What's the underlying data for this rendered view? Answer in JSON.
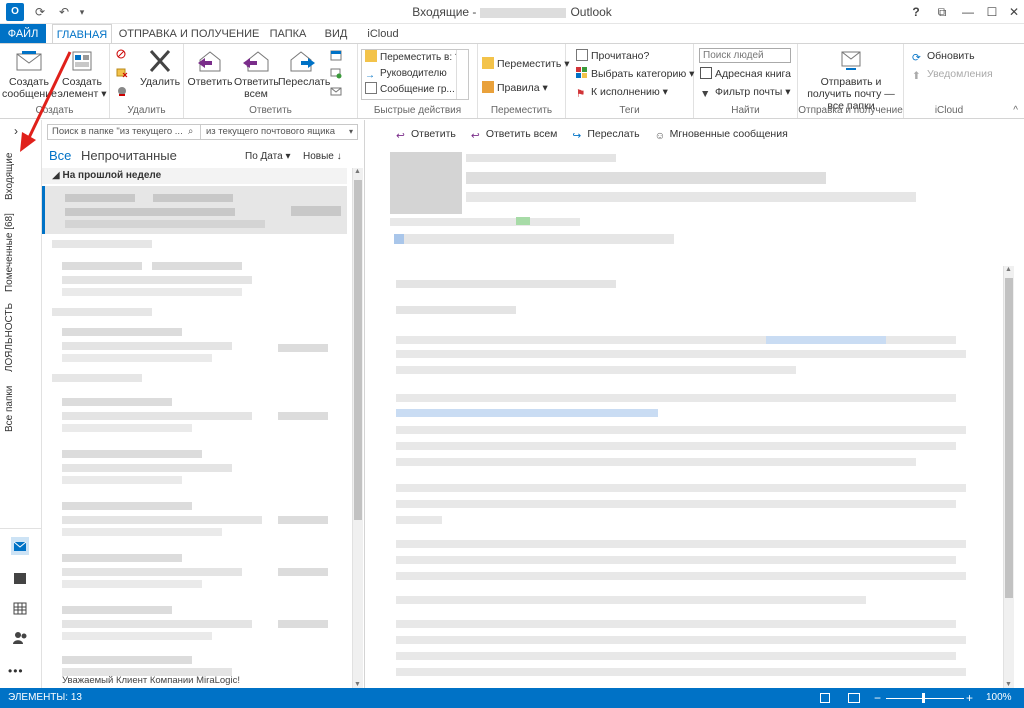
{
  "window": {
    "title": "Входящие -",
    "app_name": "Outlook",
    "app_logo": "O",
    "help": "?",
    "restore": "⧉",
    "minimize": "—",
    "maximize": "☐",
    "close": "✕"
  },
  "tabs": [
    "ФАЙЛ",
    "ГЛАВНАЯ",
    "ОТПРАВКА И ПОЛУЧЕНИЕ",
    "ПАПКА",
    "ВИД",
    "iCloud"
  ],
  "ribbon": {
    "create": {
      "label": "Создать",
      "new_message": "Создать сообщение",
      "new_item": "Создать элемент ▾"
    },
    "delete": {
      "label": "Удалить",
      "delete": "Удалить"
    },
    "respond": {
      "label": "Ответить",
      "reply": "Ответить",
      "reply_all": "Ответить всем",
      "forward": "Переслать"
    },
    "quick_steps": {
      "label": "Быстрые действия",
      "items": [
        "Переместить в: ?",
        "Руководителю",
        "Сообщение гр..."
      ]
    },
    "move": {
      "label": "Переместить",
      "move": "Переместить ▾",
      "rules": "Правила ▾"
    },
    "tags": {
      "label": "Теги",
      "read": "Прочитано?",
      "categorize": "Выбрать категорию ▾",
      "followup": "К исполнению ▾"
    },
    "find": {
      "label": "Найти",
      "search_people": "Поиск людей",
      "address_book": "Адресная книга",
      "filter": "Фильтр почты ▾"
    },
    "send_receive": {
      "label": "Отправка и получение",
      "button": "Отправить и получить почту — все папки"
    },
    "icloud": {
      "label": "iCloud",
      "refresh": "Обновить",
      "notifications": "Уведомления"
    }
  },
  "nav": {
    "expand": "›",
    "folders": [
      "Входящие",
      "Помеченные [68]",
      "ЛОЯЛЬНОСТЬ",
      "Все папки"
    ],
    "more": "•••"
  },
  "list": {
    "search_placeholder": "Поиск в папке \"из текущего ...",
    "scope": "из текущего почтового ящика",
    "filter_all": "Все",
    "filter_unread": "Непрочитанные",
    "sort_by": "По Дата ▾",
    "sort_order": "Новые ↓",
    "group_header": "На прошлой неделе",
    "last_preview": "Уважаемый Клиент Компании MiraLogic!"
  },
  "reading": {
    "reply": "Ответить",
    "reply_all": "Ответить всем",
    "forward": "Переслать",
    "im": "Мгновенные сообщения"
  },
  "status": {
    "items": "ЭЛЕМЕНТЫ: 13",
    "zoom": "100%"
  },
  "colors": {
    "accent": "#0072c6",
    "arrow": "#e0201a"
  }
}
